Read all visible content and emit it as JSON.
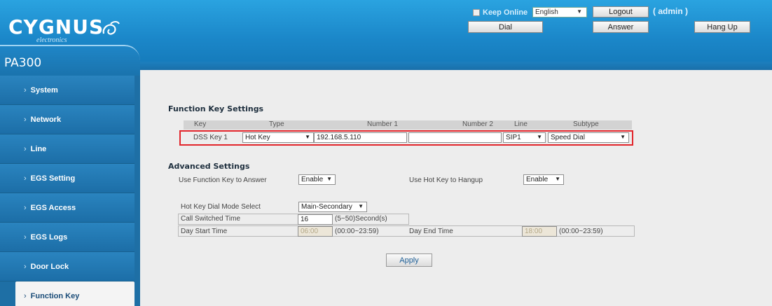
{
  "header": {
    "brand": "CYGNUS",
    "brand_sub": "electronics",
    "keep_online": "Keep Online",
    "language": "English",
    "logout": "Logout",
    "admin": "( admin )",
    "dial": "Dial",
    "answer": "Answer",
    "hang_up": "Hang Up"
  },
  "sidebar": {
    "product": "PA300",
    "items": [
      {
        "label": "System"
      },
      {
        "label": "Network"
      },
      {
        "label": "Line"
      },
      {
        "label": "EGS Setting"
      },
      {
        "label": "EGS Access"
      },
      {
        "label": "EGS Logs"
      },
      {
        "label": "Door Lock"
      },
      {
        "label": "Function Key"
      }
    ]
  },
  "function_keys": {
    "title": "Function Key Settings",
    "columns": [
      "Key",
      "Type",
      "Number 1",
      "Number 2",
      "Line",
      "Subtype"
    ],
    "row": {
      "key": "DSS Key 1",
      "type": "Hot Key",
      "number1": "192.168.5.110",
      "number2": "",
      "line": "SIP1",
      "subtype": "Speed Dial"
    }
  },
  "advanced": {
    "title": "Advanced Settings",
    "fk_answer_label": "Use Function Key to Answer",
    "fk_answer_value": "Enable",
    "hotkey_hangup_label": "Use Hot Key to Hangup",
    "hotkey_hangup_value": "Enable",
    "dial_mode_label": "Hot Key Dial Mode Select",
    "dial_mode_value": "Main-Secondary",
    "call_switched_label": "Call Switched Time",
    "call_switched_value": "16",
    "call_switched_hint": "(5~50)Second(s)",
    "day_start_label": "Day Start Time",
    "day_start_value": "06:00",
    "day_start_hint": "(00:00~23:59)",
    "day_end_label": "Day End Time",
    "day_end_value": "18:00",
    "day_end_hint": "(00:00~23:59)"
  },
  "apply": "Apply",
  "colors": {
    "header_blue": "#1b87c9",
    "sidebar_blue": "#1e6fa5",
    "highlight_red": "#e2252b"
  }
}
